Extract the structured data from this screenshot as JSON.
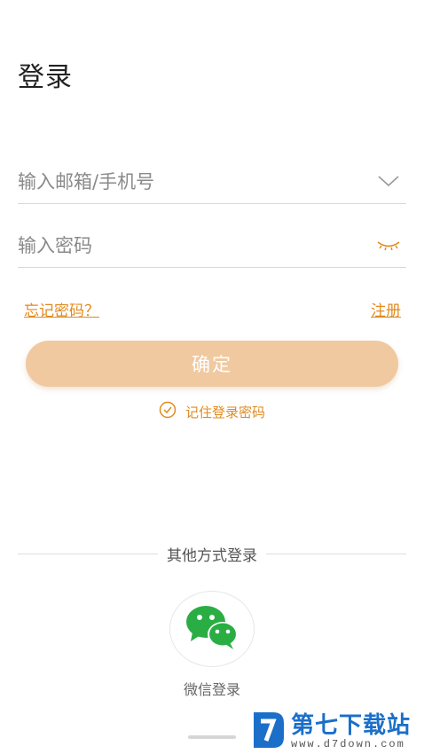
{
  "page": {
    "title": "登录"
  },
  "account_field": {
    "placeholder": "输入邮箱/手机号",
    "icon": "chevron-down-icon"
  },
  "password_field": {
    "placeholder": "输入密码",
    "icon": "eye-closed-icon"
  },
  "links": {
    "forgot": "忘记密码？",
    "register": "注册"
  },
  "confirm": {
    "label": "确定"
  },
  "remember": {
    "label": "记住登录密码",
    "checked": true
  },
  "other_login": {
    "divider_label": "其他方式登录",
    "wechat_label": "微信登录",
    "wechat_icon": "wechat-icon"
  },
  "watermark": {
    "main": "第七下载站",
    "sub": "www.d7down.com"
  },
  "colors": {
    "accent": "#e08a1e",
    "confirm_bg": "#f0c9a0",
    "wechat": "#2aae44",
    "watermark": "#1b6fc9"
  }
}
